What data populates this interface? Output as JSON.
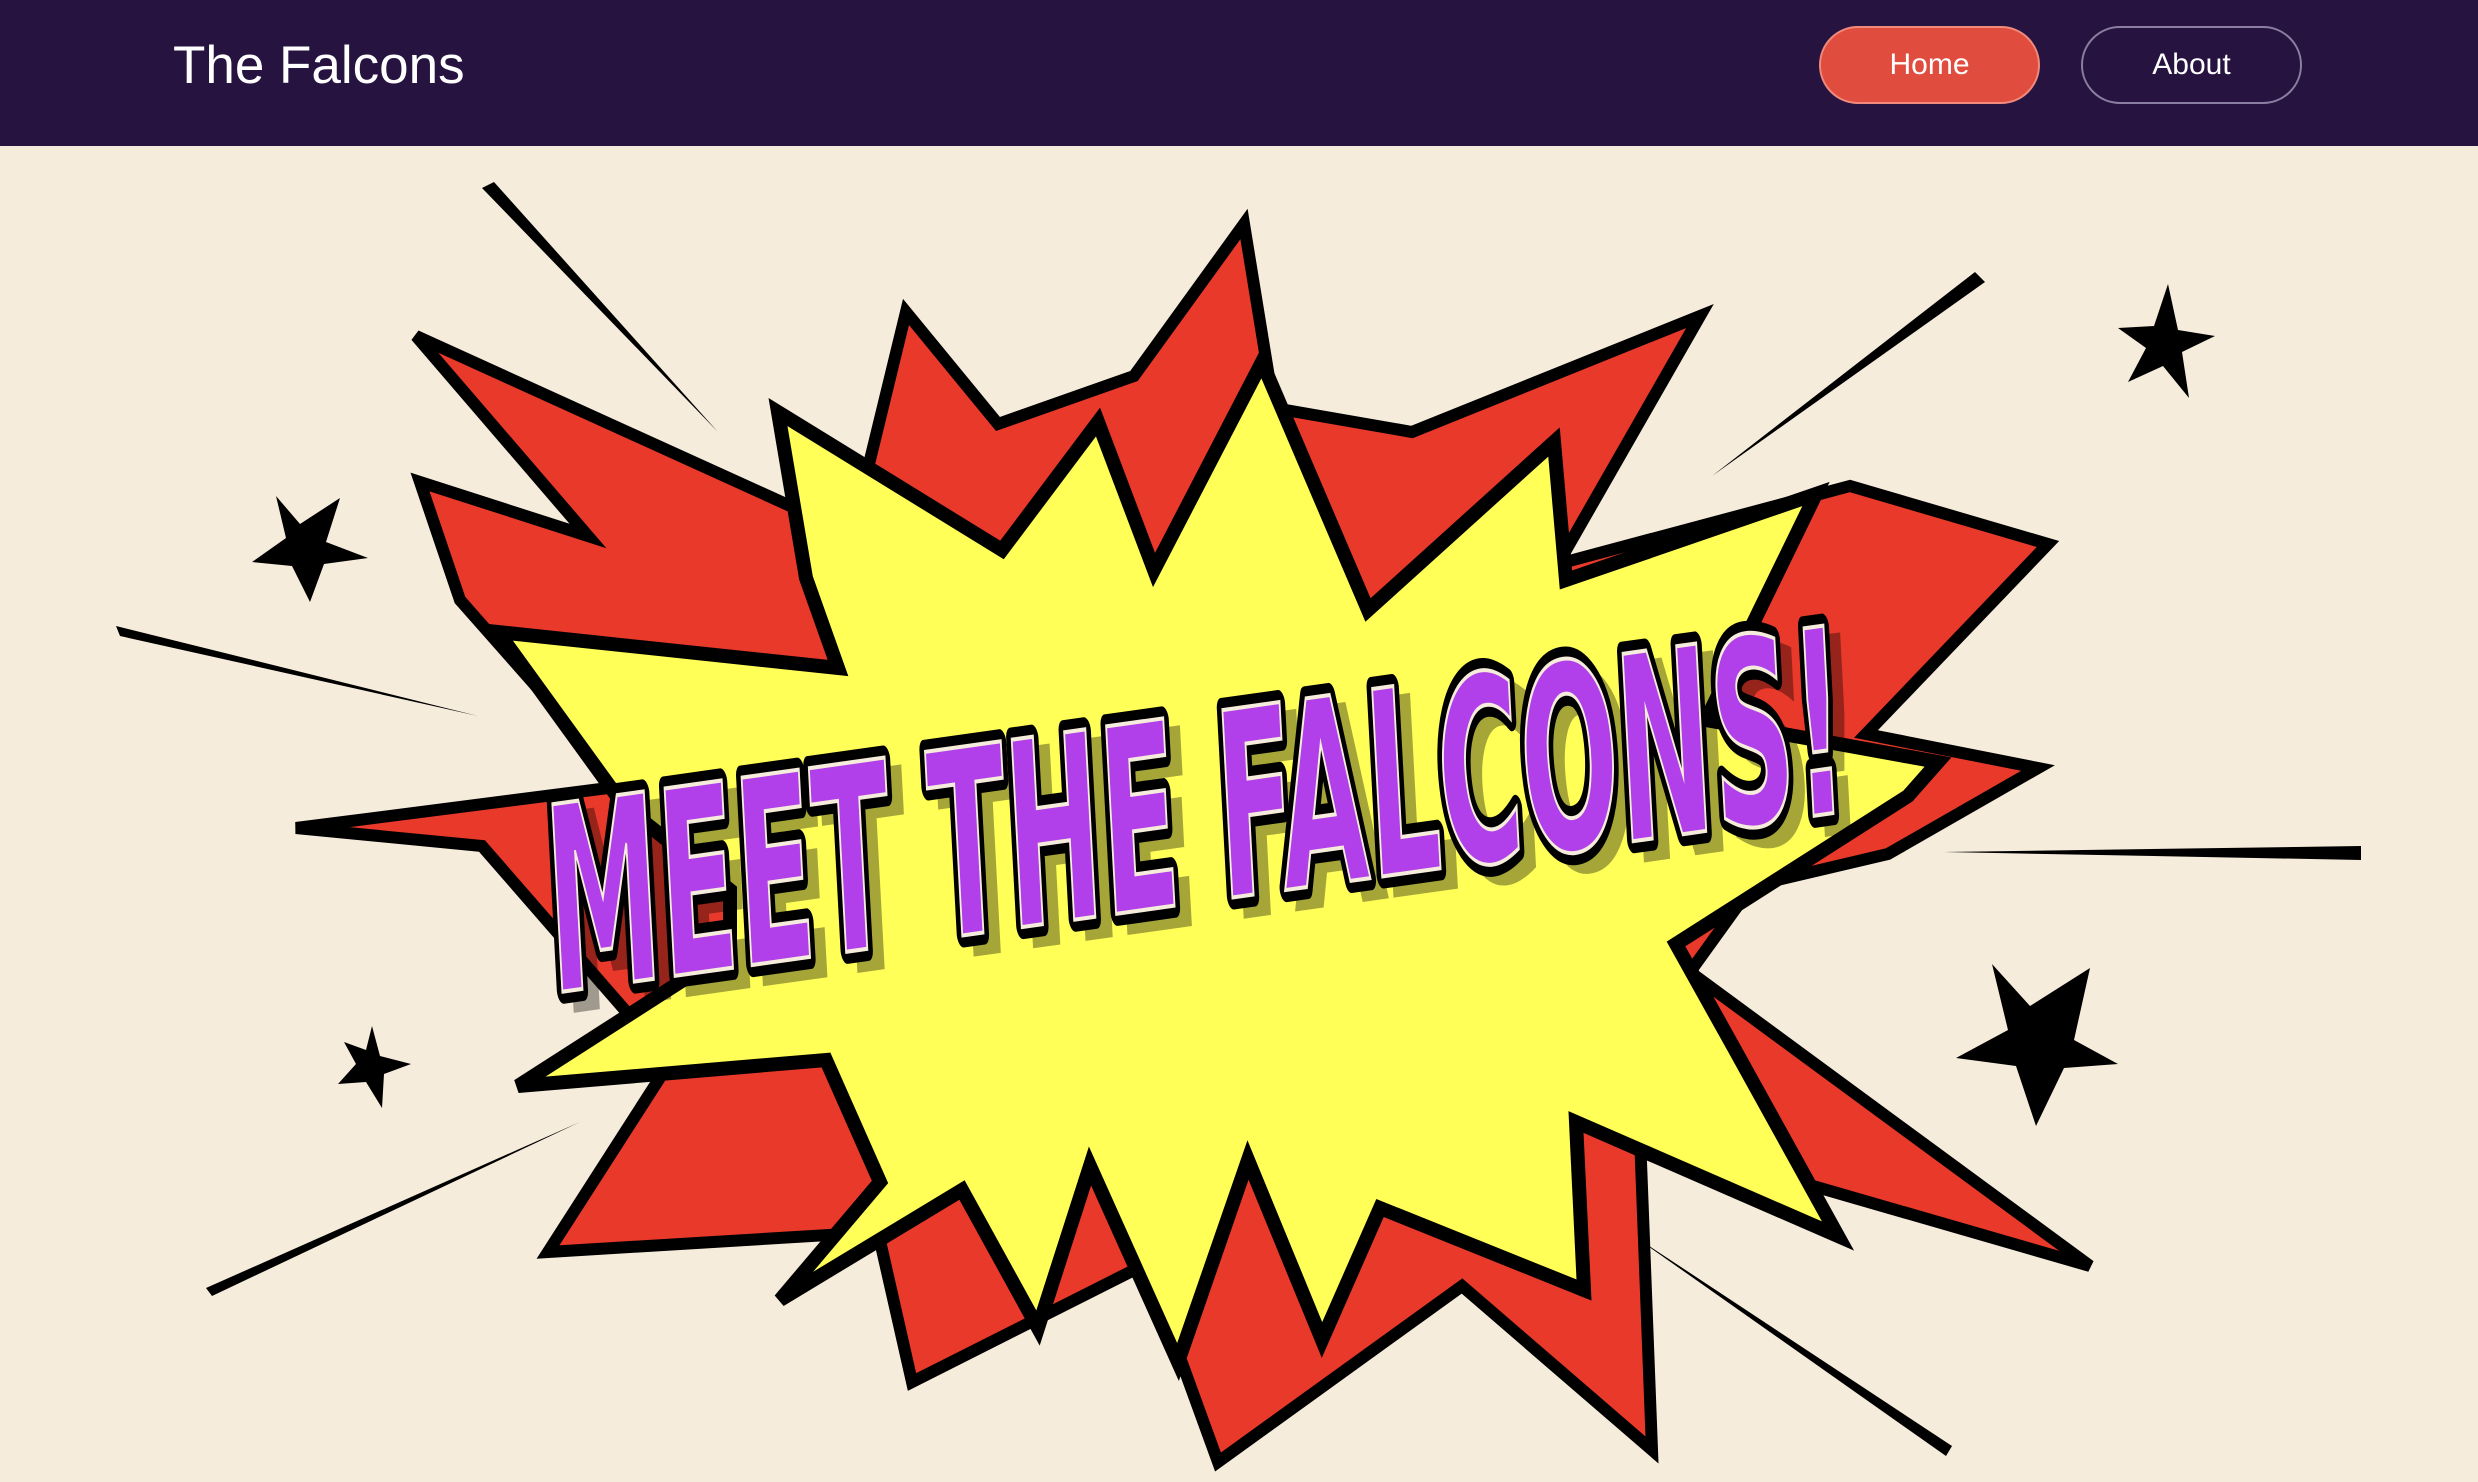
{
  "navbar": {
    "brand": "The Falcons",
    "links": [
      {
        "label": "Home",
        "active": true
      },
      {
        "label": "About",
        "active": false
      }
    ]
  },
  "hero": {
    "title": "MEET THE FALCONS!",
    "colors": {
      "background": "#f6ecdc",
      "burst_outer": "#e8392a",
      "burst_inner": "#ffff57",
      "title_fill": "#b140ea",
      "outline": "#000000"
    }
  },
  "colors": {
    "navbar_bg": "#261340",
    "accent": "#e04c3e"
  }
}
